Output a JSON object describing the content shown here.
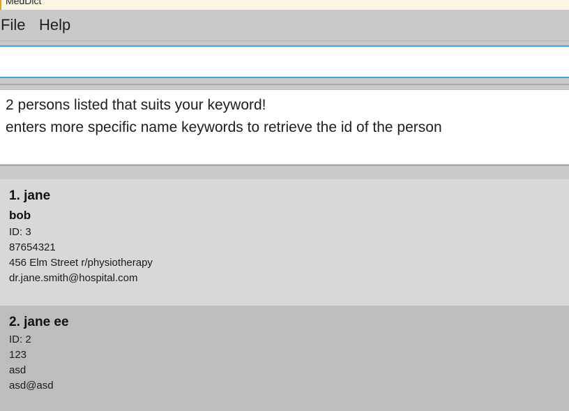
{
  "window": {
    "title": "MedDict"
  },
  "menubar": {
    "items": [
      {
        "label": "File"
      },
      {
        "label": "Help"
      }
    ]
  },
  "command_box": {
    "value": "",
    "placeholder": ""
  },
  "result_display": {
    "lines": [
      "2 persons listed that suits your keyword!",
      "enters more specific name keywords to retrieve the id of the person"
    ]
  },
  "person_list": [
    {
      "index": "1.",
      "name": "jane",
      "heading": "1. jane",
      "tags": [
        "bob"
      ],
      "id": "ID: 3",
      "phone": "87654321",
      "address": "456 Elm Street r/physiotherapy",
      "email": "dr.jane.smith@hospital.com"
    },
    {
      "index": "2.",
      "name": "jane ee",
      "heading": "2. jane ee",
      "tags": [],
      "id": "ID: 2",
      "phone": "123",
      "address": "asd",
      "email": "asd@asd"
    }
  ],
  "colors": {
    "titlebar": "#fbf6e3",
    "menubar": "#c9c9c9",
    "focus_border": "#3aa7e0",
    "card_odd": "#d8d8d8",
    "card_even": "#bdbdbd"
  }
}
